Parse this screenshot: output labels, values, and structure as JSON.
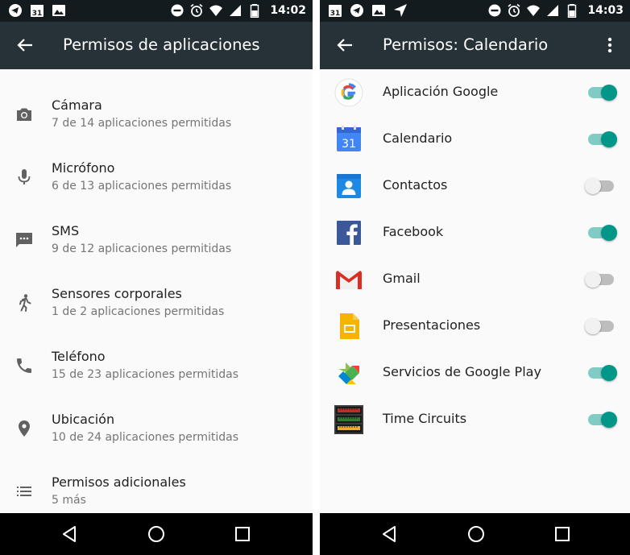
{
  "colors": {
    "appbar": "#263238",
    "statusbar": "#141b1e",
    "accent": "#009688",
    "accent_track": "#80cbc4",
    "text_primary": "#212121",
    "text_secondary": "#757575"
  },
  "left": {
    "status": {
      "time": "14:02",
      "calendar_day": "31"
    },
    "title": "Permisos de aplicaciones",
    "permissions": [
      {
        "icon": "camera-icon",
        "title": "Cámara",
        "subtitle": "7 de 14 aplicaciones permitidas"
      },
      {
        "icon": "microphone-icon",
        "title": "Micrófono",
        "subtitle": "6 de 13 aplicaciones permitidas"
      },
      {
        "icon": "sms-icon",
        "title": "SMS",
        "subtitle": "9 de 12 aplicaciones permitidas"
      },
      {
        "icon": "body-sensors-icon",
        "title": "Sensores corporales",
        "subtitle": "1 de 2 aplicaciones permitidas"
      },
      {
        "icon": "phone-icon",
        "title": "Teléfono",
        "subtitle": "15 de 23 aplicaciones permitidas"
      },
      {
        "icon": "location-icon",
        "title": "Ubicación",
        "subtitle": "10 de 24 aplicaciones permitidas"
      },
      {
        "icon": "list-icon",
        "title": "Permisos adicionales",
        "subtitle": "5 más"
      }
    ]
  },
  "right": {
    "status": {
      "time": "14:03",
      "calendar_day": "31"
    },
    "title": "Permisos: Calendario",
    "apps": [
      {
        "icon": "google-app-icon",
        "name": "Aplicación Google",
        "enabled": true
      },
      {
        "icon": "calendar-app-icon",
        "name": "Calendario",
        "enabled": true,
        "icon_text": "31"
      },
      {
        "icon": "contacts-app-icon",
        "name": "Contactos",
        "enabled": false
      },
      {
        "icon": "facebook-app-icon",
        "name": "Facebook",
        "enabled": true
      },
      {
        "icon": "gmail-app-icon",
        "name": "Gmail",
        "enabled": false
      },
      {
        "icon": "slides-app-icon",
        "name": "Presentaciones",
        "enabled": false
      },
      {
        "icon": "play-services-app-icon",
        "name": "Servicios de Google Play",
        "enabled": true
      },
      {
        "icon": "time-circuits-app-icon",
        "name": "Time Circuits",
        "enabled": true
      }
    ]
  }
}
